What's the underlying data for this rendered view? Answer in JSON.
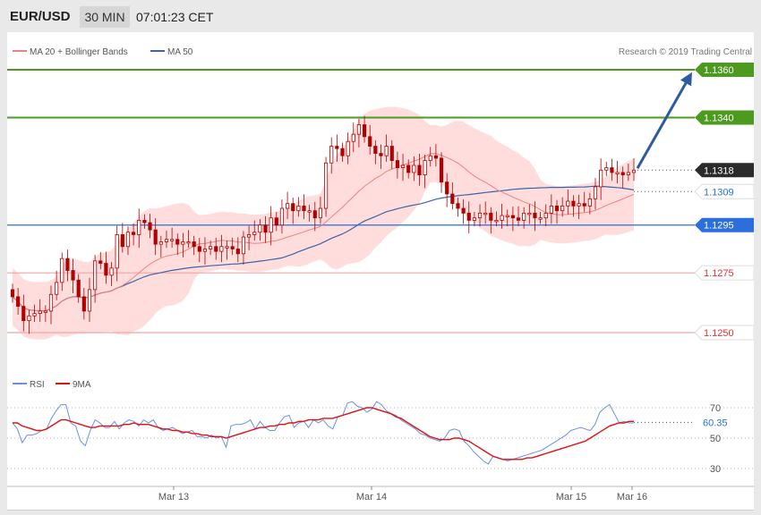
{
  "header": {
    "pair": "EUR/USD",
    "timeframe": "30 MIN",
    "clock": "07:01:23 CET"
  },
  "legend": {
    "bb_label": "MA 20 + Bollinger Bands",
    "ma50_label": "MA 50",
    "copyright": "Research © 2019 Trading Central"
  },
  "rsi_legend": {
    "rsi_label": "RSI",
    "ma9_label": "9MA"
  },
  "colors": {
    "bb_band": "#ffb3b3",
    "ma20": "#f08080",
    "ma50": "#3a66a8",
    "green": "#4c9a1f",
    "blue_level": "#2a6fdb",
    "red_level": "#f4a4a4",
    "candle": "#b00000",
    "rsi": "#6b8ee8",
    "rsi_ma": "#e01010",
    "arrow": "#2d5aa0",
    "price_tag": "#2b2b2b"
  },
  "chart_data": [
    {
      "type": "candlestick",
      "title": "",
      "ylim": [
        1.124,
        1.137
      ],
      "x_ticks": [
        "Mar 13",
        "Mar 14",
        "Mar 15",
        "Mar 16"
      ],
      "levels": [
        {
          "value": 1.136,
          "label": "1.1360",
          "color": "#4c9a1f",
          "style": "solid"
        },
        {
          "value": 1.134,
          "label": "1.1340",
          "color": "#4c9a1f",
          "style": "solid"
        },
        {
          "value": 1.1318,
          "label": "1.1318",
          "color": "#2b2b2b",
          "style": "dotted"
        },
        {
          "value": 1.1309,
          "label": "1.1309",
          "color": "#ffffff",
          "style": "dotted"
        },
        {
          "value": 1.1295,
          "label": "1.1295",
          "color": "#2a6fdb",
          "style": "solid"
        },
        {
          "value": 1.1275,
          "label": "1.1275",
          "color": "#f4a4a4",
          "style": "solid"
        },
        {
          "value": 1.125,
          "label": "1.1250",
          "color": "#f4a4a4",
          "style": "solid"
        }
      ],
      "close_series": [
        1.1265,
        1.1261,
        1.1255,
        1.1257,
        1.1258,
        1.1259,
        1.1259,
        1.1266,
        1.1271,
        1.1281,
        1.1276,
        1.1272,
        1.1265,
        1.1259,
        1.1268,
        1.128,
        1.1279,
        1.1274,
        1.1277,
        1.1291,
        1.1286,
        1.1292,
        1.1291,
        1.1297,
        1.1296,
        1.1293,
        1.1287,
        1.1288,
        1.1289,
        1.1289,
        1.1287,
        1.1288,
        1.1288,
        1.1286,
        1.1284,
        1.1285,
        1.1286,
        1.1284,
        1.1286,
        1.1286,
        1.1285,
        1.1283,
        1.129,
        1.1291,
        1.1292,
        1.1295,
        1.1292,
        1.1298,
        1.1295,
        1.1302,
        1.1304,
        1.1301,
        1.1303,
        1.1301,
        1.1301,
        1.1298,
        1.1302,
        1.1321,
        1.1328,
        1.1327,
        1.1324,
        1.133,
        1.1333,
        1.1337,
        1.1332,
        1.1328,
        1.1325,
        1.1324,
        1.1328,
        1.1322,
        1.1319,
        1.132,
        1.1317,
        1.132,
        1.1316,
        1.1322,
        1.1324,
        1.1323,
        1.1313,
        1.1308,
        1.1304,
        1.1302,
        1.13,
        1.1297,
        1.1298,
        1.13,
        1.13,
        1.1297,
        1.1297,
        1.1299,
        1.1299,
        1.1298,
        1.1297,
        1.13,
        1.13,
        1.1298,
        1.1298,
        1.13,
        1.1303,
        1.1301,
        1.1303,
        1.1305,
        1.1303,
        1.1304,
        1.1303,
        1.1306,
        1.1311,
        1.1318,
        1.1319,
        1.1317,
        1.1317,
        1.1316,
        1.1317,
        1.1318
      ],
      "annotation": "Arrow projecting from 1.1318 toward 1.1360"
    },
    {
      "type": "line",
      "title": "",
      "ylim": [
        20,
        78
      ],
      "y_ticks": [
        30,
        50,
        70
      ],
      "last_value": "60.35",
      "series": [
        {
          "name": "RSI",
          "values": [
            60,
            56,
            47,
            52,
            52,
            53,
            55,
            56,
            63,
            68,
            72,
            72,
            60,
            58,
            48,
            45,
            55,
            62,
            60,
            57,
            57,
            61,
            56,
            60,
            62,
            61,
            58,
            62,
            60,
            62,
            57,
            55,
            56,
            57,
            55,
            53,
            54,
            55,
            51,
            51,
            50,
            52,
            50,
            51,
            44,
            58,
            59,
            59,
            60,
            62,
            56,
            61,
            57,
            55,
            55,
            60,
            64,
            65,
            57,
            60,
            61,
            57,
            62,
            60,
            62,
            58,
            56,
            64,
            65,
            73,
            74,
            71,
            70,
            67,
            69,
            74,
            72,
            68,
            66,
            65,
            62,
            60,
            58,
            56,
            53,
            52,
            50,
            49,
            48,
            50,
            55,
            56,
            55,
            48,
            45,
            41,
            38,
            35,
            33,
            38,
            37,
            36,
            35,
            36,
            37,
            38,
            39,
            40,
            41,
            42,
            44,
            46,
            48,
            50,
            52,
            55,
            56,
            57,
            56,
            55,
            59,
            67,
            70,
            72,
            66,
            60,
            61,
            60,
            60
          ]
        },
        {
          "name": "9MA",
          "values": [
            60,
            60,
            58,
            57,
            56,
            55,
            55,
            56,
            58,
            60,
            62,
            62,
            61,
            60,
            59,
            58,
            57,
            57,
            58,
            58,
            58,
            58,
            58,
            59,
            59,
            60,
            59,
            59,
            59,
            58,
            57,
            56,
            56,
            55,
            55,
            54,
            54,
            53,
            53,
            52,
            52,
            51,
            51,
            51,
            50,
            51,
            52,
            53,
            54,
            55,
            56,
            57,
            57,
            58,
            58,
            59,
            59,
            60,
            60,
            61,
            61,
            62,
            62,
            62,
            63,
            63,
            63,
            64,
            65,
            66,
            67,
            68,
            69,
            70,
            70,
            69,
            68,
            67,
            66,
            64,
            63,
            61,
            59,
            57,
            55,
            53,
            51,
            50,
            49,
            49,
            49,
            50,
            50,
            49,
            48,
            46,
            44,
            42,
            40,
            38,
            37,
            36,
            36,
            36,
            36,
            36,
            37,
            37,
            38,
            39,
            40,
            41,
            42,
            43,
            44,
            45,
            46,
            47,
            48,
            50,
            52,
            54,
            56,
            58,
            59,
            60,
            60,
            61,
            61
          ]
        }
      ]
    }
  ]
}
